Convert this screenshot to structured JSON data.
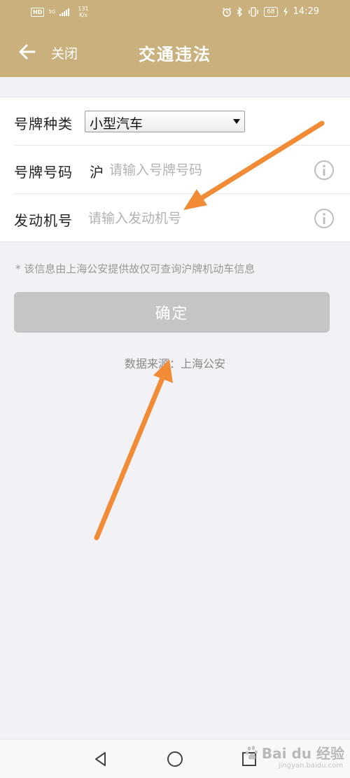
{
  "status_bar": {
    "hd": "HD",
    "network_type": "5G",
    "speed_value": "131",
    "speed_unit": "K/s",
    "battery": "68",
    "time": "14:29"
  },
  "nav": {
    "close_label": "关闭",
    "title": "交通违法"
  },
  "form": {
    "plate_type_label": "号牌种类",
    "plate_type_value": "小型汽车",
    "plate_number_label": "号牌号码",
    "plate_prefix": "沪",
    "plate_number_placeholder": "请输入号牌号码",
    "engine_label": "发动机号",
    "engine_placeholder": "请输入发动机号"
  },
  "note": "* 该信息由上海公安提供故仅可查询沪牌机动车信息",
  "confirm_label": "确定",
  "data_source": "数据来源：上海公安",
  "watermark": {
    "brand": "Bai du 经验",
    "sub": "jingyan.baidu.com"
  },
  "colors": {
    "header": "#c9b07c",
    "annotation_arrow": "#f28b35",
    "button_disabled": "#c5c5c5"
  }
}
